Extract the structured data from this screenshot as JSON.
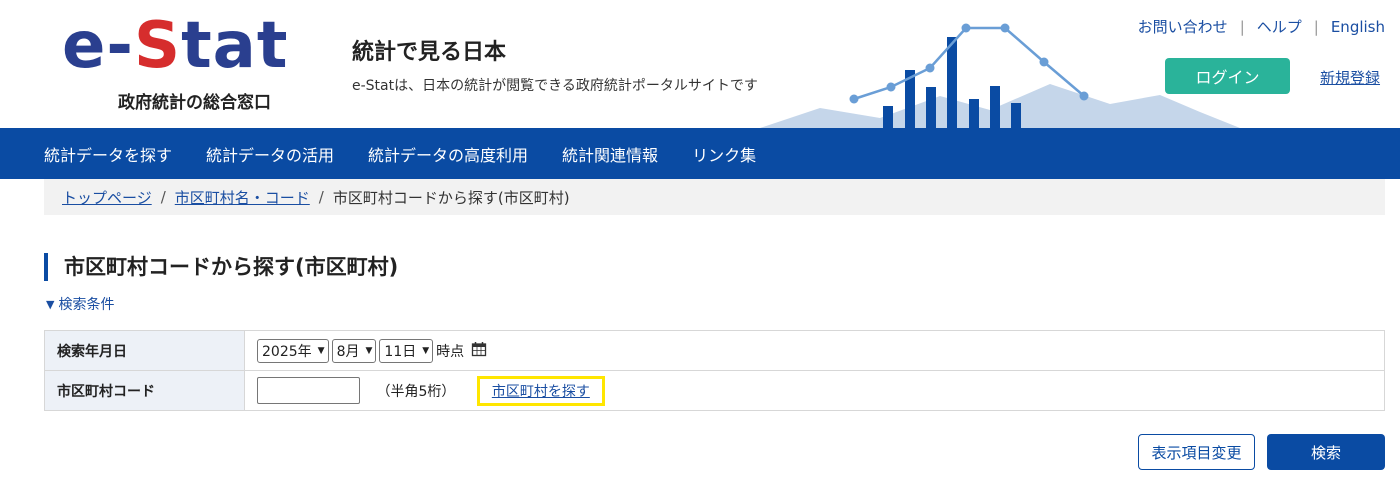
{
  "header": {
    "logo_text": "e-Stat",
    "logo_subtitle": "政府統計の総合窓口",
    "site_title": "統計で見る日本",
    "site_description": "e-Statは、日本の統計が閲覧できる政府統計ポータルサイトです",
    "top_links": [
      "お問い合わせ",
      "ヘルプ",
      "English"
    ],
    "login_label": "ログイン",
    "register_label": "新規登録",
    "brand_colors": {
      "logo_blue": "#2a3f8f",
      "logo_red": "#d62d2d",
      "nav_blue": "#0a4ba3",
      "login_green": "#2ab39a"
    }
  },
  "nav": {
    "items": [
      "統計データを探す",
      "統計データの活用",
      "統計データの高度利用",
      "統計関連情報",
      "リンク集"
    ]
  },
  "breadcrumb": {
    "items": [
      "トップページ",
      "市区町村名・コード"
    ],
    "current": "市区町村コードから探す(市区町村)",
    "separator": "/"
  },
  "page": {
    "title": "市区町村コードから探す(市区町村)",
    "conditions_toggle": "検索条件"
  },
  "conditions": {
    "date_label": "検索年月日",
    "year_value": "2025年",
    "month_value": "8月",
    "day_value": "11日",
    "date_suffix": "時点",
    "code_label": "市区町村コード",
    "code_value": "",
    "code_note": "（半角5桁）",
    "search_municipality_link": "市区町村を探す"
  },
  "actions": {
    "change_columns_label": "表示項目変更",
    "search_label": "検索"
  }
}
